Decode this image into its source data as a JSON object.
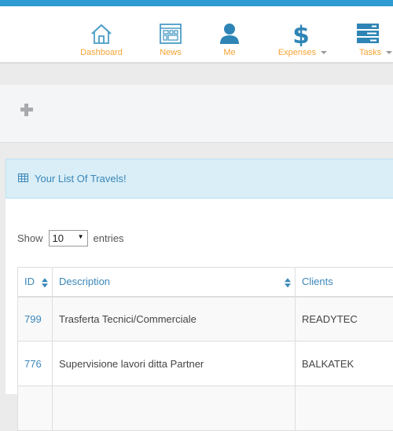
{
  "colors": {
    "top_bar": "#2e9bd3",
    "nav_label": "#f7a335",
    "icon": "#2e85b5",
    "heading_bg": "#d9eef7",
    "link": "#3a87b8"
  },
  "nav": {
    "items": [
      {
        "label": "Dashboard",
        "icon": "home-icon",
        "dropdown": false
      },
      {
        "label": "News",
        "icon": "newspaper-icon",
        "dropdown": false
      },
      {
        "label": "Me",
        "icon": "user-icon",
        "dropdown": false
      },
      {
        "label": "Expenses",
        "icon": "dollar-icon",
        "dropdown": true
      },
      {
        "label": "Tasks",
        "icon": "tasks-icon",
        "dropdown": true
      }
    ]
  },
  "actions": {
    "add_icon": "plus-icon"
  },
  "panel": {
    "title": "Your List Of Travels!",
    "title_icon": "table-icon"
  },
  "length": {
    "prefix": "Show",
    "value": "10",
    "suffix": "entries"
  },
  "table": {
    "columns": [
      "ID",
      "Description",
      "Clients"
    ],
    "rows": [
      {
        "id": "799",
        "description": "Trasferta Tecnici/Commerciale",
        "client": "READYTEC"
      },
      {
        "id": "776",
        "description": "Supervisione lavori ditta Partner",
        "client": "BALKATEK"
      },
      {
        "id": "",
        "description": "",
        "client": ""
      }
    ]
  }
}
